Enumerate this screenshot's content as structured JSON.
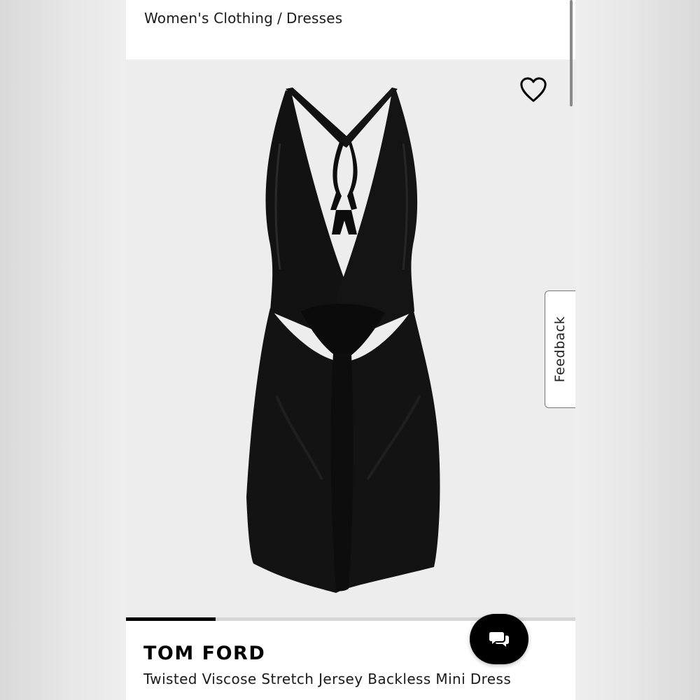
{
  "breadcrumb": {
    "category": "Women's Clothing",
    "separator": "/",
    "subcategory": "Dresses"
  },
  "product": {
    "brand": "TOM FORD",
    "name": "Twisted Viscose Stretch Jersey Backless Mini Dress",
    "image_alt": "Black twisted viscose jersey backless mini dress"
  },
  "feedback": {
    "label": "Feedback"
  },
  "carousel": {
    "progress": 0.2
  },
  "icons": {
    "wishlist": "heart-outline-icon",
    "chat": "chat-bubbles-icon"
  },
  "colors": {
    "dress": "#111111",
    "image_bg": "#ededed",
    "accent": "#000000"
  }
}
